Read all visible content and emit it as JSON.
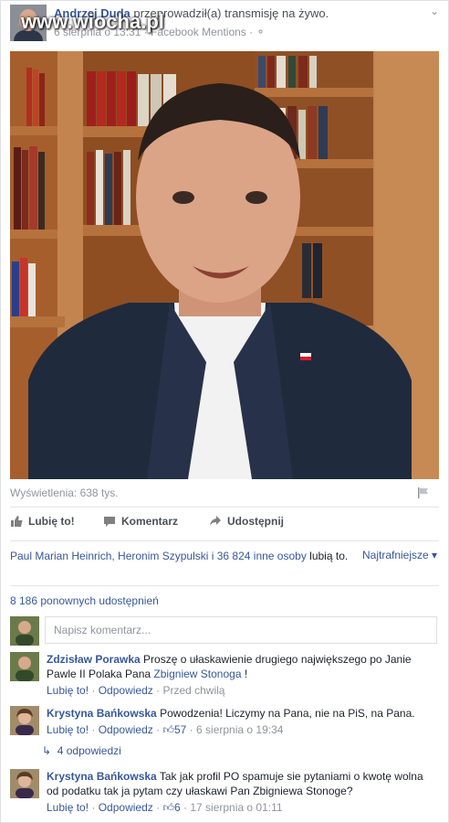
{
  "header": {
    "author": "Andrzej Duda",
    "action": "przeprowadził(a) transmisję na żywo.",
    "meta": "6 sierpnia o 13:31 · Facebook Mentions ·",
    "watermark": "www.wiocha.pl"
  },
  "video": {
    "views": "Wyświetlenia: 638 tys."
  },
  "actions": {
    "like": "Lubię to!",
    "comment": "Komentarz",
    "share": "Udostępnij"
  },
  "likes": {
    "names": "Paul Marian Heinrich, Heronim Szypulski i 36 824 inne osoby",
    "suffix": "lubią to.",
    "sort": "Najtrafniejsze"
  },
  "shares": "8 186 ponownych udostępnień",
  "composer": {
    "placeholder": "Napisz komentarz..."
  },
  "comments": [
    {
      "author": "Zdzisław Porawka",
      "text": "Proszę o ułaskawienie drugiego największego po Janie Pawle II Polaka Pana",
      "link": "Zbigniew Stonoga",
      "text_end": " !",
      "like": "Lubię to!",
      "reply": "Odpowiedz",
      "time": "Przed chwilą"
    },
    {
      "author": "Krystyna Bańkowska",
      "text": "Powodzenia! Liczymy na Pana, nie na PiS, na Pana.",
      "like": "Lubię to!",
      "reply": "Odpowiedz",
      "likes": "57",
      "time": "6 sierpnia o 19:34",
      "replies": "4 odpowiedzi"
    },
    {
      "author": "Krystyna Bańkowska",
      "text": "Tak jak profil PO spamuje sie pytaniami o kwotę wolna od podatku tak ja pytam czy ułaskawi Pan Zbigniewa Stonoge?",
      "like": "Lubię to!",
      "reply": "Odpowiedz",
      "likes": "6",
      "time": "17 sierpnia o 01:11"
    }
  ]
}
